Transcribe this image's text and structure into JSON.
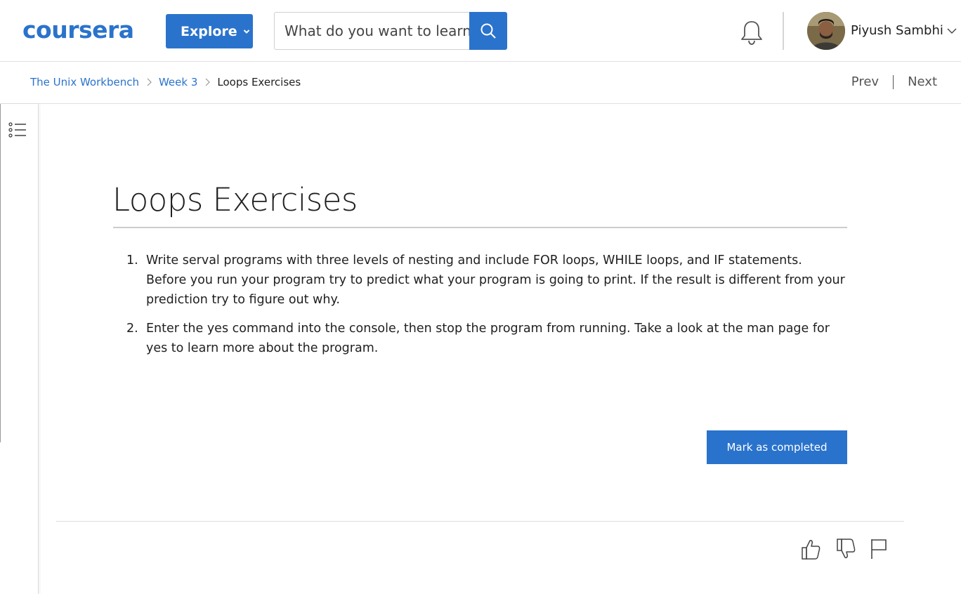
{
  "header": {
    "logo_text": "coursera",
    "explore_label": "Explore",
    "search_placeholder": "What do you want to learn?",
    "user_name": "Piyush Sambhi"
  },
  "breadcrumb": {
    "items": [
      "The Unix Workbench",
      "Week 3"
    ],
    "current": "Loops Exercises"
  },
  "nav": {
    "prev_label": "Prev",
    "next_label": "Next"
  },
  "content": {
    "title": "Loops Exercises",
    "items": [
      {
        "num": "1.",
        "text": "Write serval programs with three levels of nesting and include FOR loops, WHILE loops, and IF statements. Before you run your program try to predict what your program is going to print. If the result is different from your prediction try to figure out why."
      },
      {
        "num": "2.",
        "text": "Enter the yes command into the console, then stop the program from running. Take a look at the man page for yes to learn more about the program."
      }
    ],
    "complete_label": "Mark as completed"
  },
  "colors": {
    "brand_blue": "#2a73cc",
    "text": "#1f1f1f"
  },
  "icons": [
    "search-icon",
    "bell-icon",
    "chevron-down-icon",
    "toc-list-icon",
    "thumbs-up-icon",
    "thumbs-down-icon",
    "flag-icon"
  ]
}
